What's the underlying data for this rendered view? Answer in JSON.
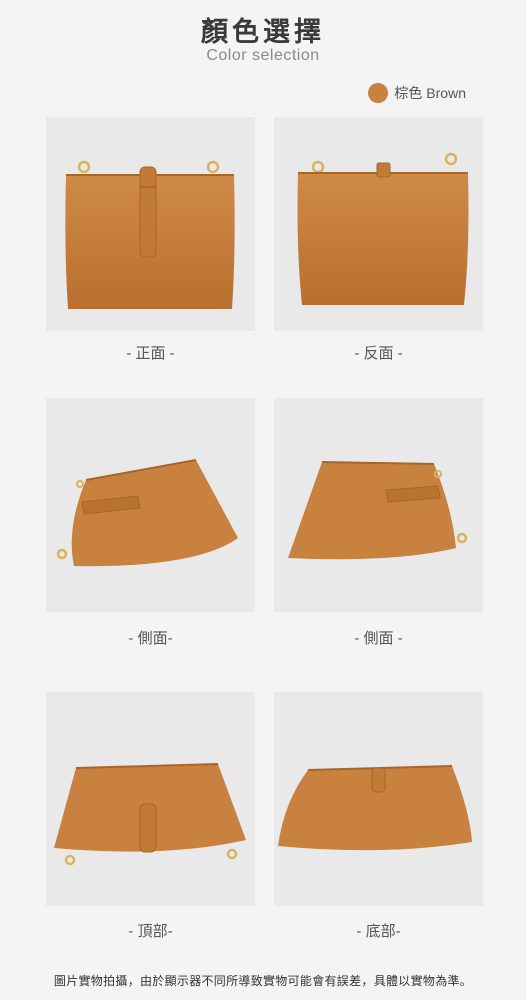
{
  "header": {
    "title": "顏色選擇",
    "subtitle": "Color selection"
  },
  "swatch": {
    "label": "棕色 Brown",
    "color": "#c8813f"
  },
  "views": [
    {
      "caption": "- 正面 -",
      "icon": "bag-front-view"
    },
    {
      "caption": "- 反面 -",
      "icon": "bag-back-view"
    },
    {
      "caption": "- 側面-",
      "icon": "bag-side-left-view"
    },
    {
      "caption": "- 側面 -",
      "icon": "bag-side-right-view"
    },
    {
      "caption": "- 頂部-",
      "icon": "bag-top-view"
    },
    {
      "caption": "- 底部-",
      "icon": "bag-bottom-view"
    }
  ],
  "footer": {
    "disclaimer": "圖片實物拍攝，由於顯示器不同所導致實物可能會有誤差，具體以實物為準。"
  },
  "colors": {
    "leather": "#c8813f",
    "leather_dark": "#a8652a",
    "hardware": "#d9b45a",
    "tile_bg": "#e9e9e9"
  }
}
